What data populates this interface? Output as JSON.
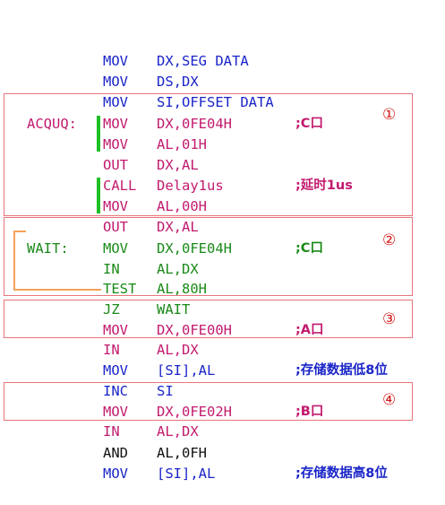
{
  "colors": {
    "blue": "#1a25c8",
    "magenta": "#c21a6e",
    "green": "#1a8a18",
    "black": "#111111",
    "box_border": "#e8747c",
    "circle_number": "#d21818",
    "green_bar": "#1fbf26",
    "orange_line": "#f4a15a"
  },
  "lines": [
    {
      "label": "",
      "op": "MOV",
      "arg": "DX,SEG DATA",
      "comment": "",
      "color": "blue"
    },
    {
      "label": "",
      "op": "MOV",
      "arg": "DS,DX",
      "comment": "",
      "color": "blue"
    },
    {
      "label": "",
      "op": "MOV",
      "arg": "SI,OFFSET DATA",
      "comment": "",
      "color": "blue"
    },
    {
      "label": "ACQUQ:",
      "op": "MOV",
      "arg": "DX,0FE04H",
      "comment": ";C口",
      "color": "magenta"
    },
    {
      "label": "",
      "op": "MOV",
      "arg": "AL,01H",
      "comment": "",
      "color": "magenta"
    },
    {
      "label": "",
      "op": "OUT",
      "arg": "DX,AL",
      "comment": "",
      "color": "magenta"
    },
    {
      "label": "",
      "op": "CALL",
      "arg": "Delay1us",
      "comment": ";延时1us",
      "color": "magenta"
    },
    {
      "label": "",
      "op": "MOV",
      "arg": "AL,00H",
      "comment": "",
      "color": "magenta"
    },
    {
      "label": "",
      "op": "OUT",
      "arg": "DX,AL",
      "comment": "",
      "color": "magenta"
    },
    {
      "label": "WAIT:",
      "op": "MOV",
      "arg": "DX,0FE04H",
      "comment": ";C口",
      "color": "green"
    },
    {
      "label": "",
      "op": "IN",
      "arg": "AL,DX",
      "comment": "",
      "color": "green"
    },
    {
      "label": "",
      "op": "TEST",
      "arg": "AL,80H",
      "comment": "",
      "color": "green"
    },
    {
      "label": "",
      "op": "JZ",
      "arg": "WAIT",
      "comment": "",
      "color": "green"
    },
    {
      "label": "",
      "op": "MOV",
      "arg": "DX,0FE00H",
      "comment": ";A口",
      "color": "magenta"
    },
    {
      "label": "",
      "op": "IN",
      "arg": "AL,DX",
      "comment": "",
      "color": "magenta"
    },
    {
      "label": "",
      "op": "MOV",
      "arg": "[SI],AL",
      "comment": ";存储数据低8位",
      "color": "blue"
    },
    {
      "label": "",
      "op": "INC",
      "arg": "SI",
      "comment": "",
      "color": "blue"
    },
    {
      "label": "",
      "op": "MOV",
      "arg": "DX,0FE02H",
      "comment": ";B口",
      "color": "magenta"
    },
    {
      "label": "",
      "op": "IN",
      "arg": "AL,DX",
      "comment": "",
      "color": "magenta"
    },
    {
      "label": "",
      "op": "AND",
      "arg": "AL,0FH",
      "comment": "",
      "color": "black"
    },
    {
      "label": "",
      "op": "MOV",
      "arg": "[SI],AL",
      "comment": ";存储数据高8位",
      "color": "blue"
    }
  ],
  "sections": [
    "①",
    "②",
    "③",
    "④"
  ]
}
